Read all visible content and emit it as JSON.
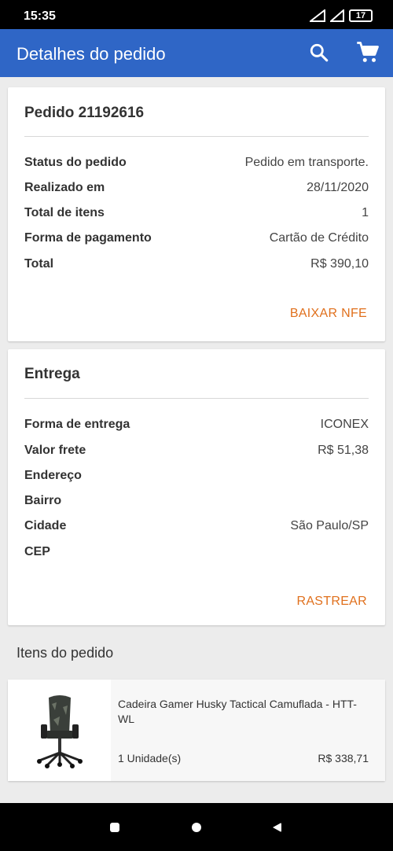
{
  "status_bar": {
    "time": "15:35",
    "battery": "17"
  },
  "app_bar": {
    "title": "Detalhes do pedido"
  },
  "order": {
    "title": "Pedido 21192616",
    "rows": [
      {
        "label": "Status do pedido",
        "value": "Pedido em transporte."
      },
      {
        "label": "Realizado em",
        "value": "28/11/2020"
      },
      {
        "label": "Total de itens",
        "value": "1"
      },
      {
        "label": "Forma de pagamento",
        "value": "Cartão de Crédito"
      },
      {
        "label": "Total",
        "value": "R$ 390,10"
      }
    ],
    "action_label": "BAIXAR NFE"
  },
  "delivery": {
    "title": "Entrega",
    "rows": [
      {
        "label": "Forma de entrega",
        "value": "ICONEX"
      },
      {
        "label": "Valor frete",
        "value": "R$ 51,38"
      },
      {
        "label": "Endereço",
        "value": ""
      },
      {
        "label": "Bairro",
        "value": ""
      },
      {
        "label": "Cidade",
        "value": "São Paulo/SP"
      },
      {
        "label": "CEP",
        "value": ""
      }
    ],
    "action_label": "RASTREAR"
  },
  "items_section": {
    "heading": "Itens do pedido",
    "items": [
      {
        "name": "Cadeira Gamer Husky Tactical Camuflada - HTT-WL",
        "quantity": "1 Unidade(s)",
        "price": "R$ 338,71"
      }
    ]
  },
  "colors": {
    "app_bar": "#2f66c6",
    "accent": "#e0701d",
    "background": "#ececec"
  }
}
